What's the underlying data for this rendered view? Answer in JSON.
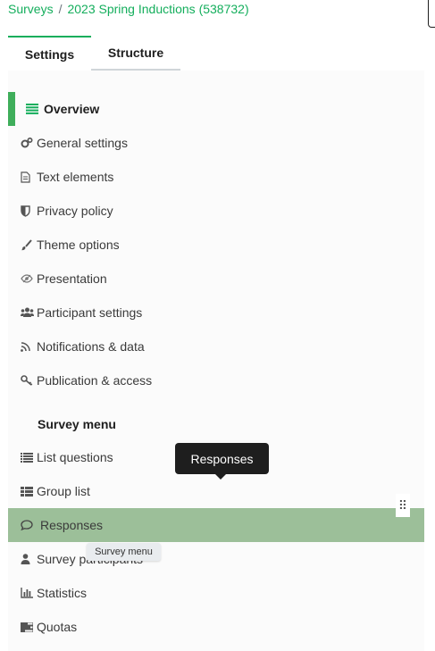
{
  "breadcrumb": {
    "root": "Surveys",
    "separator": "/",
    "survey": "2023 Spring Inductions (538732)"
  },
  "tabs": [
    {
      "label": "Settings",
      "active": true
    },
    {
      "label": "Structure",
      "active": false
    }
  ],
  "menu": {
    "overview": {
      "label": "Overview",
      "icon": "list-lines-icon"
    },
    "settings_items": [
      {
        "label": "General settings",
        "icon": "gears-icon"
      },
      {
        "label": "Text elements",
        "icon": "document-icon"
      },
      {
        "label": "Privacy policy",
        "icon": "shield-icon"
      },
      {
        "label": "Theme options",
        "icon": "brush-icon"
      },
      {
        "label": "Presentation",
        "icon": "eye-icon"
      },
      {
        "label": "Participant settings",
        "icon": "users-icon"
      },
      {
        "label": "Notifications & data",
        "icon": "feed-icon"
      },
      {
        "label": "Publication & access",
        "icon": "key-icon"
      }
    ],
    "survey_menu_title": "Survey menu",
    "survey_items": [
      {
        "label": "List questions",
        "icon": "list-icon"
      },
      {
        "label": "Group list",
        "icon": "th-list-icon"
      },
      {
        "label": "Responses",
        "icon": "comment-icon",
        "active": true
      },
      {
        "label": "Survey participants",
        "icon": "user-icon"
      },
      {
        "label": "Statistics",
        "icon": "bar-chart-icon"
      },
      {
        "label": "Quotas",
        "icon": "tasks-icon"
      }
    ]
  },
  "tooltips": {
    "responses": "Responses",
    "survey_menu": "Survey menu"
  },
  "drag_handle": "⠿",
  "colors": {
    "accent": "#14ae5c",
    "active_row": "#9cbf99",
    "tooltip_bg": "#1e1e1e"
  }
}
